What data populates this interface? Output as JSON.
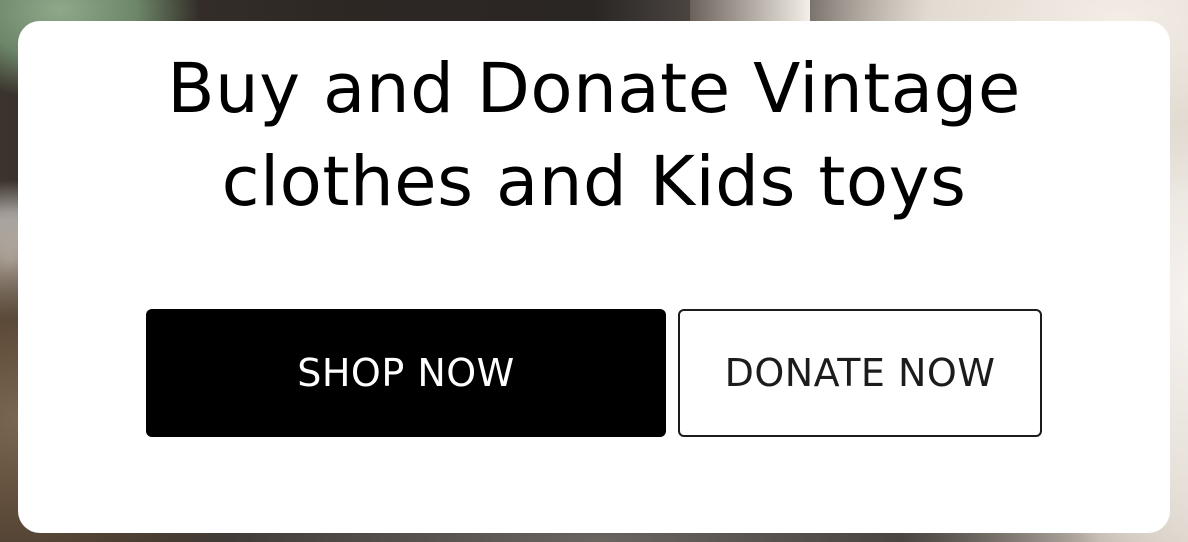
{
  "hero": {
    "headline_line1": "Buy and Donate Vintage",
    "headline_line2": "clothes and Kids toys",
    "shop_button_label": "SHOP NOW",
    "donate_button_label": "DONATE NOW"
  },
  "colors": {
    "card_background": "#ffffff",
    "primary_button": "#000000",
    "primary_button_text": "#ffffff",
    "secondary_button_border": "#1c1c1c"
  }
}
